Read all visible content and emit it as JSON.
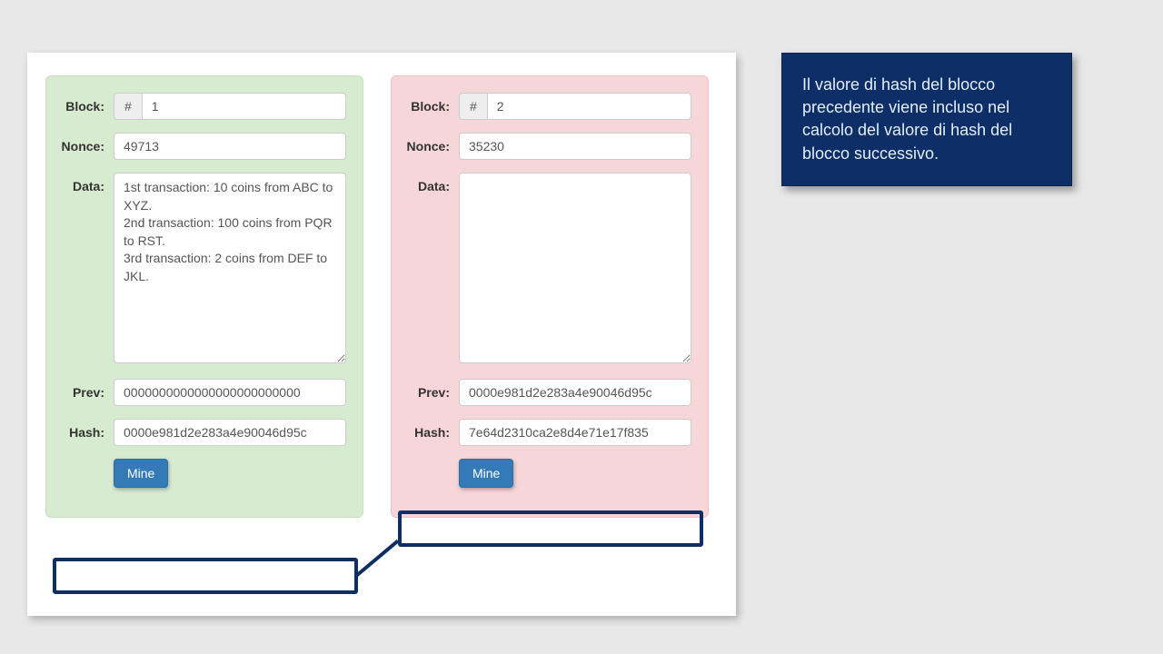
{
  "labels": {
    "block": "Block:",
    "nonce": "Nonce:",
    "data": "Data:",
    "prev": "Prev:",
    "hash": "Hash:",
    "mine": "Mine",
    "hash_prefix": "#"
  },
  "blocks": {
    "b1": {
      "number": "1",
      "nonce": "49713",
      "data": "1st transaction: 10 coins from ABC to XYZ.\n2nd transaction: 100 coins from PQR to RST.\n3rd transaction: 2 coins from DEF to JKL.",
      "prev": "0000000000000000000000000",
      "hash": "0000e981d2e283a4e90046d95c"
    },
    "b2": {
      "number": "2",
      "nonce": "35230",
      "data": "",
      "prev": "0000e981d2e283a4e90046d95c",
      "hash": "7e64d2310ca2e8d4e71e17f835"
    }
  },
  "callout": "Il valore di hash del blocco precedente viene incluso nel calcolo del valore di hash del blocco successivo."
}
